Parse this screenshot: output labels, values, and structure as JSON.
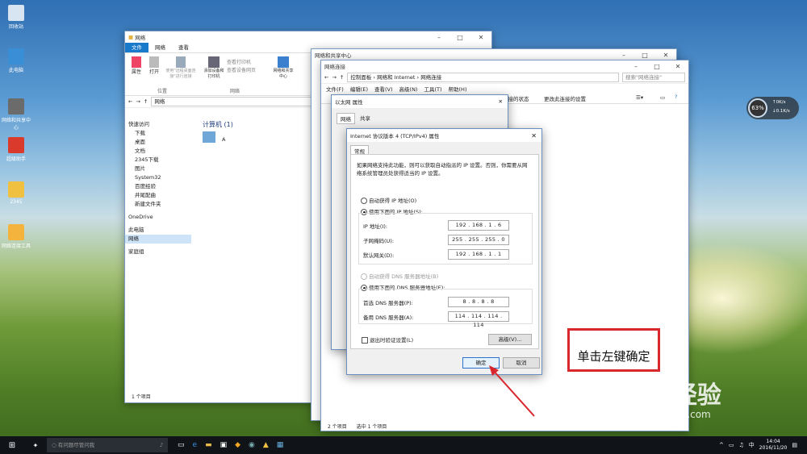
{
  "desktop": {
    "icons": [
      "回收站",
      "此电脑",
      "网络和共享中心",
      "超级助手",
      "2345",
      "网络连接工具"
    ]
  },
  "explorer": {
    "title": "网络",
    "tabs": [
      "文件",
      "网络",
      "查看"
    ],
    "ribbon": [
      "属性",
      "打开",
      "使用\"远程桌面连接\"进行连接",
      "添加设备和打印机",
      "查看打印机",
      "查看设备网页",
      "网络和共享中心"
    ],
    "ribbon_groups": [
      "位置",
      "网络"
    ],
    "address": "网络",
    "nav": [
      "快速访问",
      "下载",
      "桌面",
      "文档",
      "2345下载",
      "图片",
      "System32",
      "百度经验",
      "井尾配曲",
      "新建文件夹",
      "OneDrive",
      "此电脑",
      "网络",
      "家庭组"
    ],
    "section_header": "计算机 (1)",
    "computer_name": "A",
    "status": "1 个项目"
  },
  "sharing_center": {
    "title": "网络和共享中心"
  },
  "netconn": {
    "title": "网络连接",
    "breadcrumb": [
      "控制面板",
      "网络和 Internet",
      "网络连接"
    ],
    "search_placeholder": "搜索\"网络连接\"",
    "menu": [
      "文件(F)",
      "编辑(E)",
      "查看(V)",
      "高级(N)",
      "工具(T)",
      "帮助(H)"
    ],
    "commands": [
      "连接的状态",
      "更改此连接的设置"
    ],
    "status": [
      "2 个项目",
      "选中 1 个项目"
    ]
  },
  "ethernet_props": {
    "title": "以太网 属性",
    "tabs": [
      "网络",
      "共享"
    ]
  },
  "ipv4": {
    "title": "Internet 协议版本 4 (TCP/IPv4) 属性",
    "tab": "常规",
    "description": "如果网络支持此功能，则可以获取自动指派的 IP 设置。否则，你需要从网络系统管理员处获得适当的 IP 设置。",
    "auto_ip": "自动获得 IP 地址(O)",
    "manual_ip": "使用下面的 IP 地址(S):",
    "ip_label": "IP 地址(I):",
    "ip_value": "192 . 168 . 1 . 6",
    "mask_label": "子网掩码(U):",
    "mask_value": "255 . 255 . 255 . 0",
    "gateway_label": "默认网关(D):",
    "gateway_value": "192 . 168 . 1 . 1",
    "auto_dns": "自动获得 DNS 服务器地址(B)",
    "manual_dns": "使用下面的 DNS 服务器地址(E):",
    "dns1_label": "首选 DNS 服务器(P):",
    "dns1_value": "8 . 8 . 8 . 8",
    "dns2_label": "备用 DNS 服务器(A):",
    "dns2_value": "114 . 114 . 114 . 114",
    "validate": "退出时验证设置(L)",
    "advanced": "高级(V)...",
    "ok": "确定",
    "cancel": "取消"
  },
  "widget": {
    "percent": "63%",
    "up": "0K/s",
    "down": "0.1K/s"
  },
  "annotation": "单击左键确定",
  "watermark": {
    "brand": "Bai 经验",
    "url": "jingyan.baidu.com"
  },
  "taskbar": {
    "search_placeholder": "有问题尽管问我",
    "time": "14:04",
    "date": "2016/11/20"
  }
}
